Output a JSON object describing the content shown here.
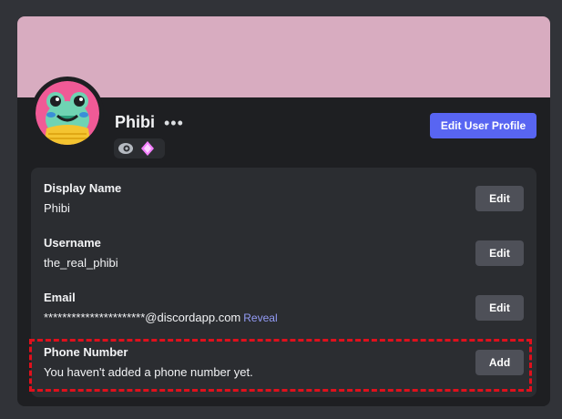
{
  "profile": {
    "username": "Phibi",
    "more_icon": "more-dots-icon",
    "edit_profile_label": "Edit User Profile",
    "banner_color": "#d8acc0",
    "accent_color": "#5865f2",
    "badges": [
      "hypesquad-badge-icon",
      "nitro-gem-badge-icon"
    ]
  },
  "fields": [
    {
      "label": "Display Name",
      "value": "Phibi",
      "action": "Edit"
    },
    {
      "label": "Username",
      "value": "the_real_phibi",
      "action": "Edit"
    },
    {
      "label": "Email",
      "value": "**********************@discordapp.com",
      "reveal": "Reveal",
      "action": "Edit"
    },
    {
      "label": "Phone Number",
      "value": "You haven't added a phone number yet.",
      "action": "Add"
    }
  ],
  "highlight_color": "#e0101c"
}
